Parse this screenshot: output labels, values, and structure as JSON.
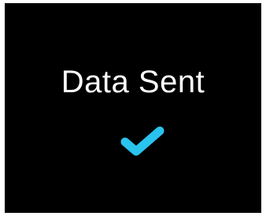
{
  "screen": {
    "message": "Data Sent",
    "status_icon": "checkmark-icon",
    "accent_color": "#29c3ee",
    "background_color": "#000000",
    "text_color": "#ffffff"
  }
}
